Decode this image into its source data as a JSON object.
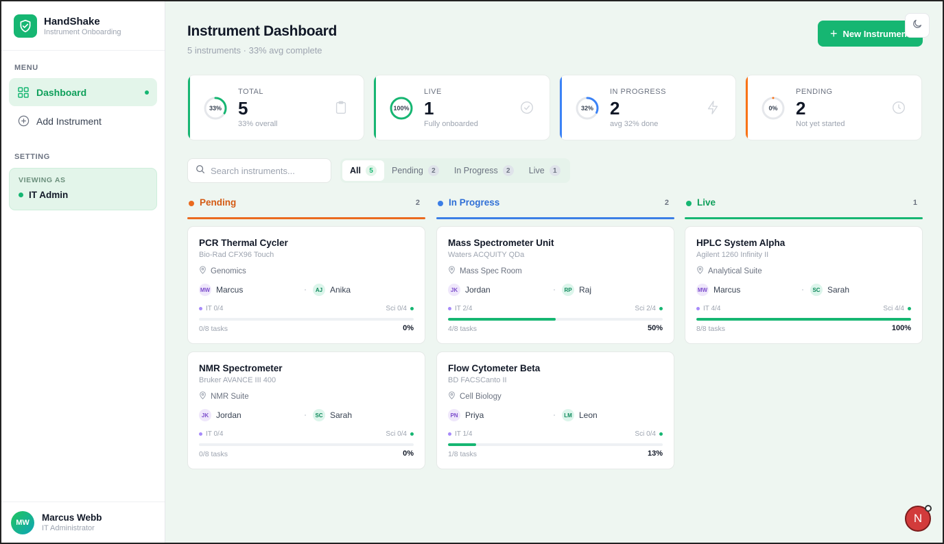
{
  "brand": {
    "title": "HandShake",
    "subtitle": "Instrument Onboarding"
  },
  "sidebar": {
    "menu_label": "MENU",
    "items": [
      {
        "label": "Dashboard",
        "icon": "grid-icon",
        "active": true
      },
      {
        "label": "Add Instrument",
        "icon": "plus-circle-icon",
        "active": false
      }
    ],
    "setting_label": "SETTING",
    "viewing_label": "VIEWING AS",
    "viewing_role": "IT Admin"
  },
  "user": {
    "initials": "MW",
    "name": "Marcus Webb",
    "role": "IT Administrator"
  },
  "header": {
    "title": "Instrument Dashboard",
    "subtitle": "5 instruments · 33% avg complete",
    "new_button": "New Instrument"
  },
  "stats": [
    {
      "label": "TOTAL",
      "value": "5",
      "note": "33% overall",
      "ring_text": "33%",
      "progress": 0.33,
      "color": "#16b672",
      "icon": "clipboard-icon"
    },
    {
      "label": "LIVE",
      "value": "1",
      "note": "Fully onboarded",
      "ring_text": "100%",
      "progress": 1.0,
      "color": "#16b672",
      "icon": "check-circle-icon"
    },
    {
      "label": "IN PROGRESS",
      "value": "2",
      "note": "avg 32% done",
      "ring_text": "32%",
      "progress": 0.32,
      "color": "#3b82f6",
      "icon": "lightning-icon"
    },
    {
      "label": "PENDING",
      "value": "2",
      "note": "Not yet started",
      "ring_text": "0%",
      "progress": 0,
      "color": "#f97316",
      "icon": "clock-icon"
    }
  ],
  "search": {
    "placeholder": "Search instruments..."
  },
  "filters": [
    {
      "label": "All",
      "count": "5",
      "active": true
    },
    {
      "label": "Pending",
      "count": "2",
      "active": false
    },
    {
      "label": "In Progress",
      "count": "2",
      "active": false
    },
    {
      "label": "Live",
      "count": "1",
      "active": false
    }
  ],
  "columns": [
    {
      "title": "Pending",
      "count": "2",
      "color": "#ea6a1f",
      "text_color": "#d45a13"
    },
    {
      "title": "In Progress",
      "count": "2",
      "color": "#3b7ee6",
      "text_color": "#2f6fd6"
    },
    {
      "title": "Live",
      "count": "1",
      "color": "#16b672",
      "text_color": "#0e9f5a"
    }
  ],
  "cards": [
    {
      "title": "PCR Thermal Cycler",
      "model": "Bio-Rad CFX96 Touch",
      "location": "Genomics",
      "it_initials": "MW",
      "it_name": "Marcus",
      "sci_initials": "AJ",
      "sci_name": "Anika",
      "it_progress": "IT 0/4",
      "sci_progress": "Sci 0/4",
      "tasks": "0/8 tasks",
      "percent": "0%",
      "fill": 0
    },
    {
      "title": "NMR Spectrometer",
      "model": "Bruker AVANCE III 400",
      "location": "NMR Suite",
      "it_initials": "JK",
      "it_name": "Jordan",
      "sci_initials": "SC",
      "sci_name": "Sarah",
      "it_progress": "IT 0/4",
      "sci_progress": "Sci 0/4",
      "tasks": "0/8 tasks",
      "percent": "0%",
      "fill": 0
    },
    {
      "title": "Mass Spectrometer Unit",
      "model": "Waters ACQUITY QDa",
      "location": "Mass Spec Room",
      "it_initials": "JK",
      "it_name": "Jordan",
      "sci_initials": "RP",
      "sci_name": "Raj",
      "it_progress": "IT 2/4",
      "sci_progress": "Sci 2/4",
      "tasks": "4/8 tasks",
      "percent": "50%",
      "fill": 0.5
    },
    {
      "title": "Flow Cytometer Beta",
      "model": "BD FACSCanto II",
      "location": "Cell Biology",
      "it_initials": "PN",
      "it_name": "Priya",
      "sci_initials": "LM",
      "sci_name": "Leon",
      "it_progress": "IT 1/4",
      "sci_progress": "Sci 0/4",
      "tasks": "1/8 tasks",
      "percent": "13%",
      "fill": 0.13
    },
    {
      "title": "HPLC System Alpha",
      "model": "Agilent 1260 Infinity II",
      "location": "Analytical Suite",
      "it_initials": "MW",
      "it_name": "Marcus",
      "sci_initials": "SC",
      "sci_name": "Sarah",
      "it_progress": "IT 4/4",
      "sci_progress": "Sci 4/4",
      "tasks": "8/8 tasks",
      "percent": "100%",
      "fill": 1.0
    }
  ],
  "fab": {
    "letter": "N"
  }
}
